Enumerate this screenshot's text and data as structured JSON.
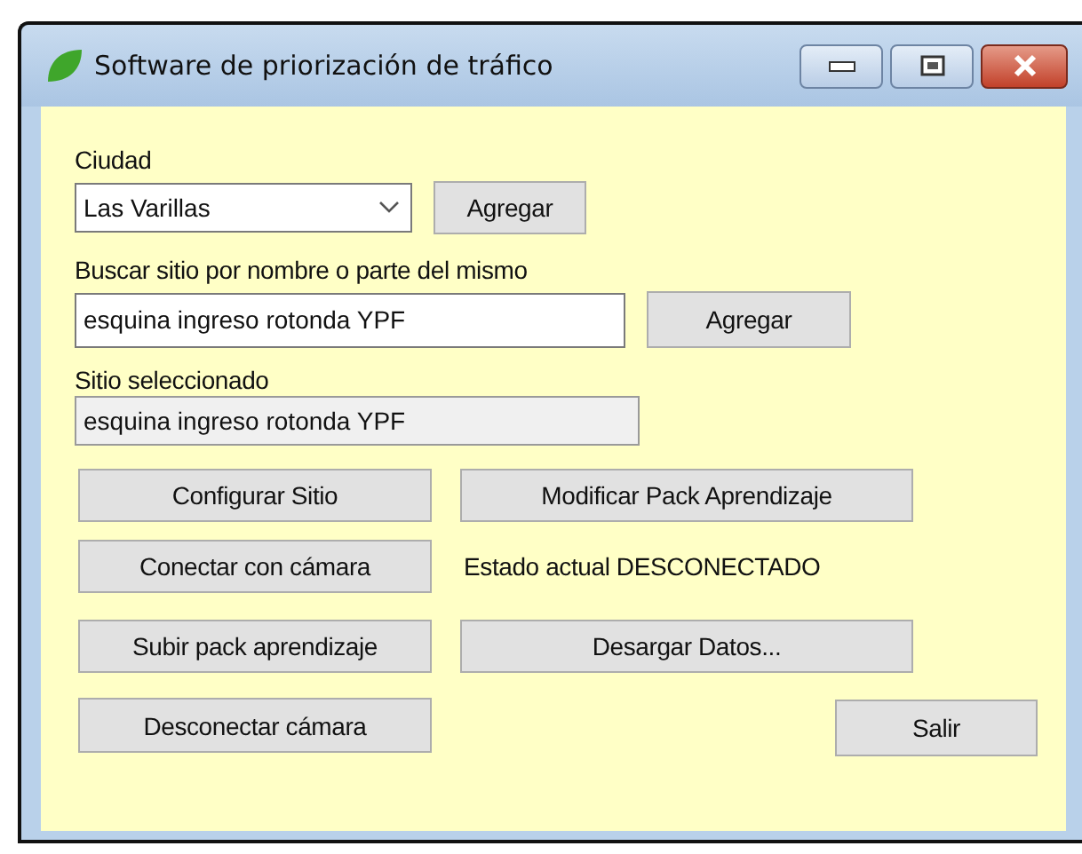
{
  "window": {
    "title": "Software de priorización de tráfico"
  },
  "city": {
    "label": "Ciudad",
    "value": "Las Varillas",
    "button": "Agregar"
  },
  "search": {
    "label": "Buscar sitio por nombre o parte del mismo",
    "value": "esquina ingreso rotonda YPF",
    "button": "Agregar"
  },
  "selected_site": {
    "label": "Sitio seleccionado",
    "value": "esquina ingreso rotonda YPF"
  },
  "actions": {
    "configure": "Configurar Sitio",
    "modify_pack": "Modificar Pack Aprendizaje",
    "connect": "Conectar con cámara",
    "status": "Estado actual DESCONECTADO",
    "upload_pack": "Subir pack aprendizaje",
    "download": "Desargar Datos...",
    "disconnect": "Desconectar cámara",
    "exit": "Salir"
  }
}
